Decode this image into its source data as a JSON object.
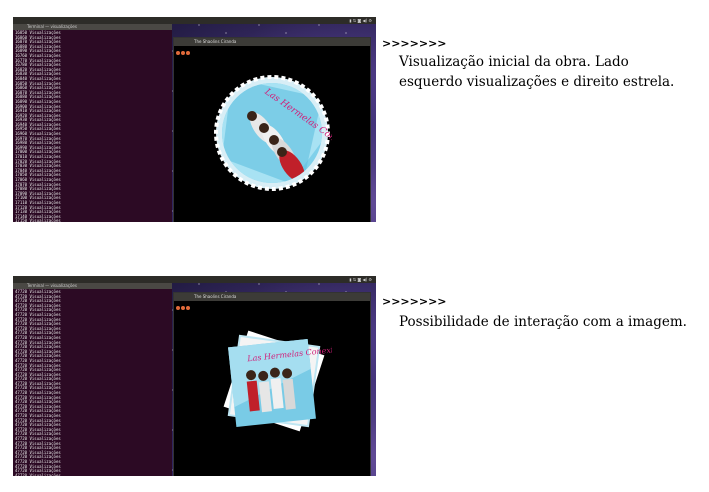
{
  "annotations": [
    {
      "arrow": ">>>>>>>",
      "caption": "Visualização inicial da obra. Lado esquerdo visualizações e direito estrela."
    },
    {
      "arrow": ">>>>>>>",
      "caption": "Possibilidade de interação com a imagem."
    }
  ],
  "screenshot1": {
    "terminal_title": "Terminal — visualizações",
    "gl_title": "The Shaolins Ciranda",
    "lines": [
      "16850 Visualizações",
      "16860 Visualizações",
      "16870 Visualizações",
      "16880 Visualizações",
      "16890 Visualizações",
      "16760 Visualizações",
      "16770 Visualizações",
      "16780 Visualizações",
      "16820 Visualizações",
      "16830 Visualizações",
      "16840 Visualizações",
      "16850 Visualizações",
      "16860 Visualizações",
      "16870 Visualizações",
      "16880 Visualizações",
      "16890 Visualizações",
      "16900 Visualizações",
      "16910 Visualizações",
      "16920 Visualizações",
      "16930 Visualizações",
      "16940 Visualizações",
      "16950 Visualizações",
      "16960 Visualizações",
      "16970 Visualizações",
      "16980 Visualizações",
      "16990 Visualizações",
      "17000 Visualizações",
      "17010 Visualizações",
      "17020 Visualizações",
      "17030 Visualizações",
      "17040 Visualizações",
      "17050 Visualizações",
      "17060 Visualizações",
      "17070 Visualizações",
      "17080 Visualizações",
      "17090 Visualizações",
      "17100 Visualizações",
      "17110 Visualizações",
      "17120 Visualizações",
      "17130 Visualizações",
      "17140 Visualizações",
      "17150 Visualizações"
    ]
  },
  "screenshot2": {
    "terminal_title": "Terminal — visualizações",
    "gl_title": "The Shaolins Ciranda",
    "lines": [
      "47720 Visualizações",
      "47720 Visualizações",
      "47720 Visualizações",
      "47720 Visualizações",
      "47720 Visualizações",
      "47720 Visualizações",
      "47720 Visualizações",
      "47720 Visualizações",
      "47720 Visualizações",
      "47720 Visualizações",
      "47720 Visualizações",
      "47720 Visualizações",
      "47720 Visualizações",
      "47720 Visualizações",
      "47720 Visualizações",
      "47720 Visualizações",
      "47720 Visualizações",
      "47720 Visualizações",
      "47720 Visualizações",
      "47720 Visualizações",
      "47720 Visualizações",
      "47720 Visualizações",
      "47720 Visualizações",
      "47720 Visualizações",
      "47720 Visualizações",
      "47720 Visualizações",
      "47720 Visualizações",
      "47720 Visualizações",
      "47720 Visualizações",
      "47720 Visualizações",
      "47720 Visualizações",
      "47720 Visualizações",
      "47720 Visualizações",
      "47720 Visualizações",
      "47720 Visualizações",
      "47720 Visualizações",
      "47720 Visualizações",
      "47720 Visualizações",
      "47720 Visualizações",
      "47720 Visualizações",
      "47720 Visualizações"
    ]
  },
  "artwork_text": "Las Hermelas Conexion"
}
